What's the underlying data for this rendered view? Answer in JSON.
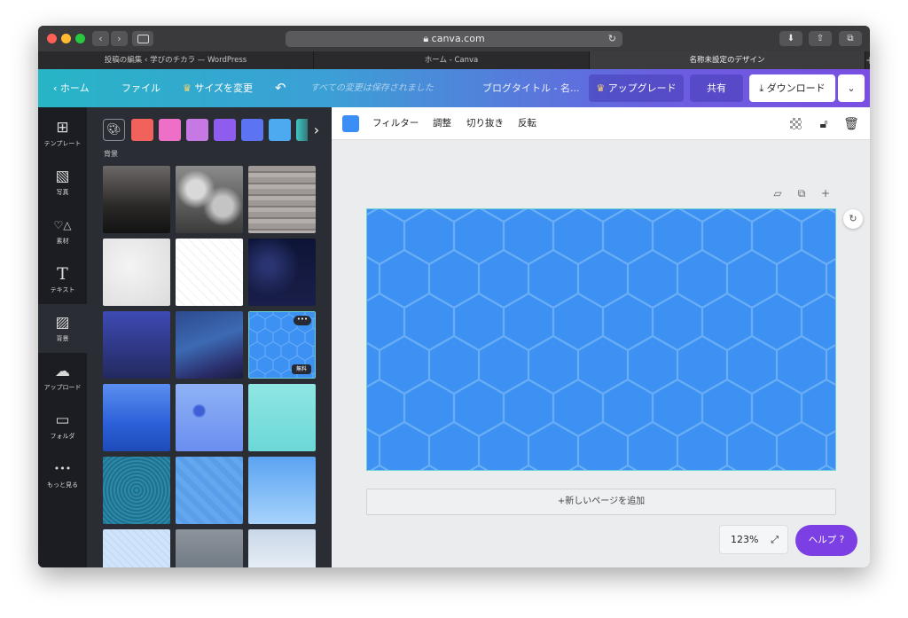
{
  "browser": {
    "url": "canva.com",
    "tabs": [
      {
        "label": "投稿の編集 ‹ 学びのチカラ — WordPress",
        "active": false
      },
      {
        "label": "ホーム - Canva",
        "active": false
      },
      {
        "label": "名称未設定のデザイン",
        "active": true
      }
    ],
    "new_tab_label": "+"
  },
  "header": {
    "home": "ホーム",
    "file": "ファイル",
    "resize": "サイズを変更",
    "saved_status": "すべての変更は保存されました",
    "doc_title": "ブログタイトル - 名...",
    "upgrade": "アップグレード",
    "share": "共有",
    "download": "ダウンロード"
  },
  "rail": [
    {
      "label": "テンプレート",
      "icon": "template-icon",
      "glyph": "⊞",
      "active": false
    },
    {
      "label": "写真",
      "icon": "photo-icon",
      "glyph": "▧",
      "active": false
    },
    {
      "label": "素材",
      "icon": "elements-icon",
      "glyph": "♡△",
      "active": false
    },
    {
      "label": "テキスト",
      "icon": "text-icon",
      "glyph": "T",
      "active": false
    },
    {
      "label": "背景",
      "icon": "background-icon",
      "glyph": "▨",
      "active": true
    },
    {
      "label": "アップロード",
      "icon": "upload-icon",
      "glyph": "☁",
      "active": false
    },
    {
      "label": "フォルダ",
      "icon": "folder-icon",
      "glyph": "▭",
      "active": false
    },
    {
      "label": "もっと見る",
      "icon": "more-icon",
      "glyph": "•••",
      "active": false
    }
  ],
  "panel": {
    "section_label": "背景",
    "swatch_colors": [
      "#f0625b",
      "#ee6fc6",
      "#c679e3",
      "#8f5cf0",
      "#5c73f2",
      "#4eaaf0",
      "#3fc8c5"
    ],
    "thumb_badge_more": "•••",
    "thumb_badge_free": "無料"
  },
  "toolbar": {
    "fill_color": "#3b8ef5",
    "filter": "フィルター",
    "adjust": "調整",
    "crop": "切り抜き",
    "flip": "反転"
  },
  "canvas": {
    "background_color": "#3c91f2",
    "pattern_color": "#6aaef6",
    "add_page": "+新しいページを追加"
  },
  "footer": {
    "zoom": "123%",
    "help": "ヘルプ ?"
  }
}
